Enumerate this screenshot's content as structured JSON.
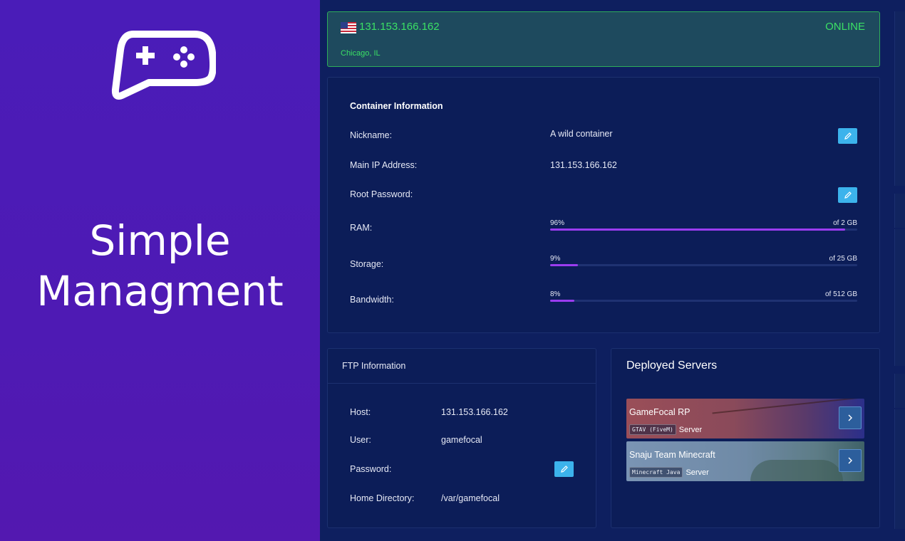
{
  "promo": {
    "headline_line1": "Simple",
    "headline_line2": "Managment",
    "icon": "gamepad-icon"
  },
  "status": {
    "ip": "131.153.166.162",
    "state": "ONLINE",
    "location": "Chicago, IL",
    "flag": "us-flag-icon",
    "color": "#3be065"
  },
  "container": {
    "title": "Container Information",
    "nickname_label": "Nickname:",
    "nickname_value": "A wild container",
    "ip_label": "Main IP Address:",
    "ip_value": "131.153.166.162",
    "root_label": "Root Password:",
    "ram_label": "RAM:",
    "ram_pct_text": "96%",
    "ram_total": "of 2 GB",
    "ram_level": 96,
    "storage_label": "Storage:",
    "storage_pct_text": "9%",
    "storage_total": "of 25 GB",
    "storage_level": 9,
    "bandwidth_label": "Bandwidth:",
    "bandwidth_pct_text": "8%",
    "bandwidth_total": "of 512 GB",
    "bandwidth_level": 8,
    "meter_color": "#9b3cf0"
  },
  "ftp": {
    "title": "FTP Information",
    "host_label": "Host:",
    "host_value": "131.153.166.162",
    "user_label": "User:",
    "user_value": "gamefocal",
    "password_label": "Password:",
    "home_label": "Home Directory:",
    "home_value": "/var/gamefocal"
  },
  "deployed": {
    "title": "Deployed Servers",
    "servers": [
      {
        "name": "GameFocal RP",
        "tag": "GTAV (FiveM)",
        "suffix": "Server"
      },
      {
        "name": "Snaju Team Minecraft",
        "tag": "Minecraft Java",
        "suffix": "Server"
      }
    ]
  },
  "colors": {
    "edit_button": "#3cb3ec",
    "background": "#0e1f5f",
    "promo": "#4e1ab4"
  }
}
